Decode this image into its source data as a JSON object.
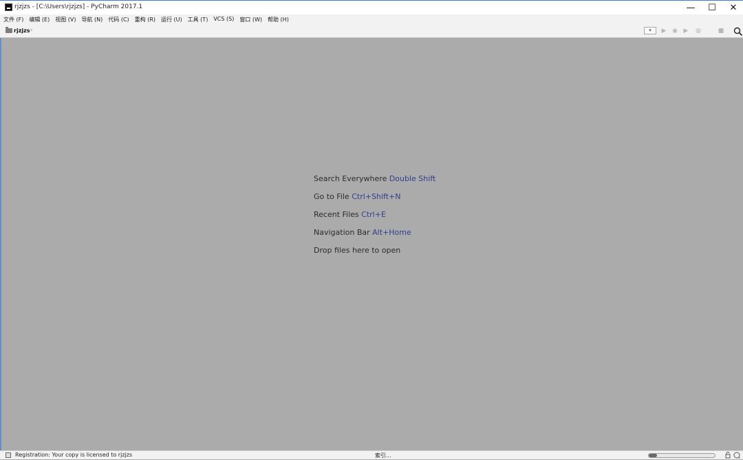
{
  "window": {
    "title": "rjzjzs - [C:\\Users\\rjzjzs] - PyCharm 2017.1",
    "controls": {
      "minimize": "—",
      "maximize": "☐",
      "close": "✕"
    }
  },
  "menu": [
    "文件 (F)",
    "编辑 (E)",
    "视图 (V)",
    "导航 (N)",
    "代码 (C)",
    "重构 (R)",
    "运行 (U)",
    "工具 (T)",
    "VCS (S)",
    "窗口 (W)",
    "帮助 (H)"
  ],
  "navbar": {
    "breadcrumb": "rjzjzs",
    "separator": "›",
    "config_combo": "▾"
  },
  "toolbar_icons": {
    "run": "▶",
    "debug": "◉",
    "coverage": "▶",
    "profile": "◍",
    "stop": "■",
    "search": "search-icon"
  },
  "editor_hints": [
    {
      "text": "Search Everywhere ",
      "key": "Double Shift"
    },
    {
      "text": "Go to File ",
      "key": "Ctrl+Shift+N"
    },
    {
      "text": "Recent Files ",
      "key": "Ctrl+E"
    },
    {
      "text": "Navigation Bar ",
      "key": "Alt+Home"
    },
    {
      "text": "Drop files here to open",
      "key": ""
    }
  ],
  "status": {
    "message": "Registration: Your copy is licensed to rjzjzs",
    "indexing": "索引...",
    "progress_fraction": 0.12
  },
  "colors": {
    "editor_bg": "#ababab",
    "shortcut_key": "#2f3f8f",
    "chrome_bg": "#f2f2f2"
  }
}
